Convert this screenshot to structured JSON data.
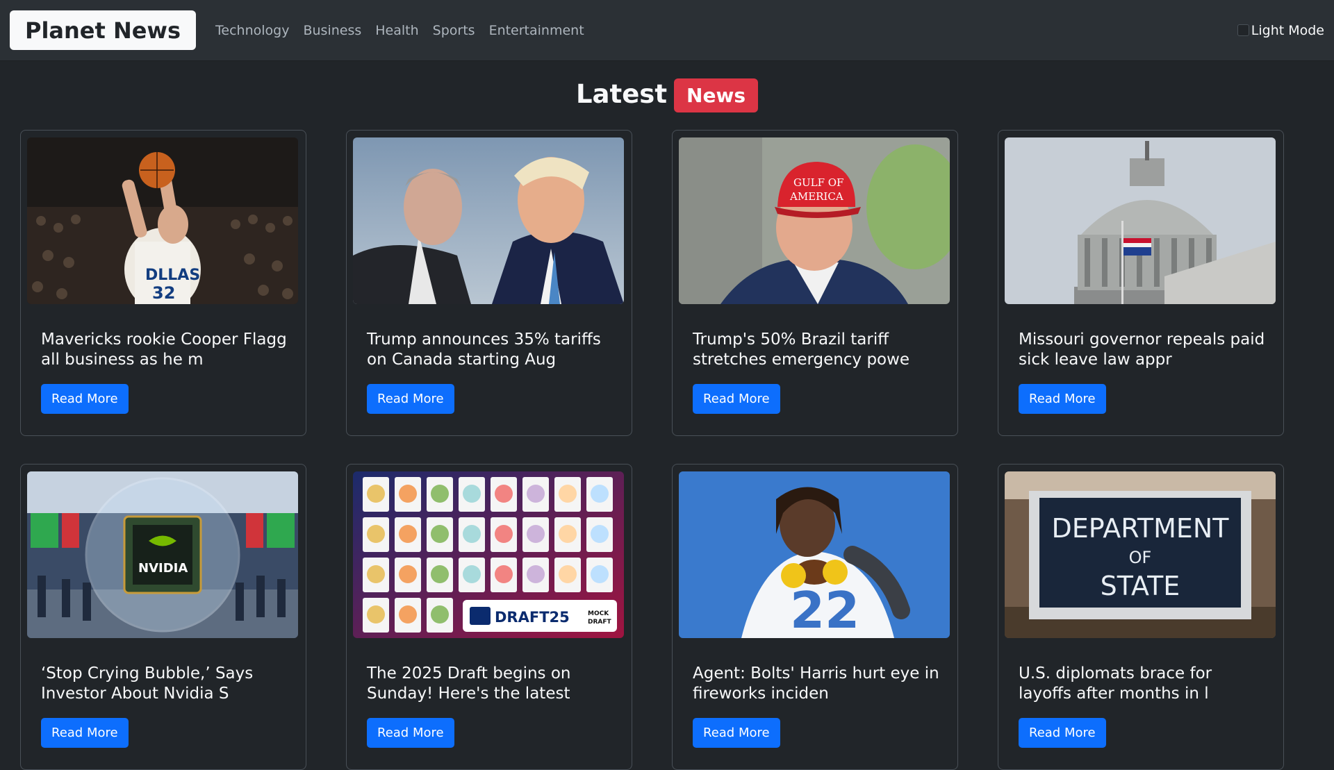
{
  "brand": "Planet News",
  "nav": [
    "Technology",
    "Business",
    "Health",
    "Sports",
    "Entertainment"
  ],
  "mode_toggle_label": "Light Mode",
  "heading": {
    "title": "Latest",
    "badge": "News"
  },
  "read_more_label": "Read More",
  "cards": [
    {
      "title": "Mavericks rookie Cooper Flagg all business as he m",
      "image": "basketball-player-photo"
    },
    {
      "title": "Trump announces 35% tariffs on Canada starting Aug",
      "image": "two-men-talking-photo"
    },
    {
      "title": "Trump's 50% Brazil tariff stretches emergency powe",
      "image": "man-in-red-cap-photo"
    },
    {
      "title": "Missouri governor repeals paid sick leave law appr",
      "image": "capitol-dome-photo"
    },
    {
      "title": "‘Stop Crying Bubble,’ Says Investor About Nvidia S",
      "image": "nvidia-chip-bubble-photo",
      "image_text": "NVIDIA"
    },
    {
      "title": "The 2025 Draft begins on Sunday! Here's the latest",
      "image": "mock-draft-grid-photo",
      "image_text": "DRAFT25",
      "image_text2": "MOCK DRAFT"
    },
    {
      "title": "Agent: Bolts' Harris hurt eye in fireworks inciden",
      "image": "football-player-photo",
      "image_text": "22"
    },
    {
      "title": "U.S. diplomats brace for layoffs after months in l",
      "image": "department-of-state-sign-photo",
      "image_text": [
        "DEPARTMENT",
        "OF",
        "STATE"
      ]
    }
  ],
  "colors": {
    "navbar_bg": "#2b3035",
    "page_bg": "#212529",
    "badge_red": "#dc3545",
    "button_blue": "#0d6efd"
  }
}
